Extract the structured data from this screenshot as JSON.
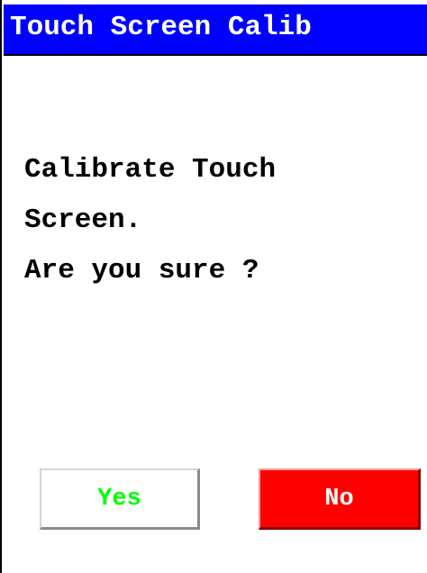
{
  "window": {
    "title": "Touch Screen Calib"
  },
  "message": {
    "lines": [
      "Calibrate Touch",
      "Screen.",
      "Are you sure ?"
    ]
  },
  "buttons": {
    "yes_label": "Yes",
    "no_label": "No"
  },
  "colors": {
    "titlebar_bg": "#0000ff",
    "title_text": "#ffffff",
    "yes_text": "#00ff00",
    "yes_bg": "#ffffff",
    "no_bg": "#ff0000",
    "no_text": "#ffffff"
  }
}
